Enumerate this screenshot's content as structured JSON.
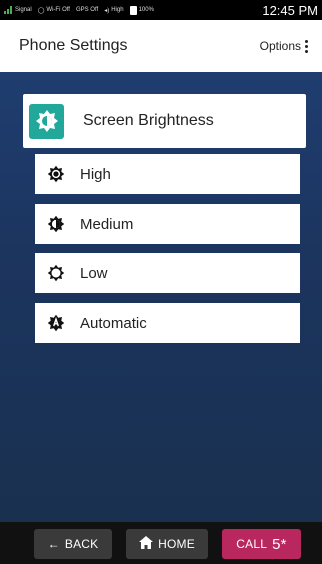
{
  "status_bar": {
    "signal": "Signal",
    "wifi": "Wi-Fi Off",
    "gps": "GPS Off",
    "volume": "High",
    "battery": "100%",
    "time": "12:45 PM"
  },
  "header": {
    "title": "Phone Settings",
    "options_label": "Options"
  },
  "main_card": {
    "label": "Screen Brightness",
    "icon": "brightness-icon"
  },
  "options": [
    {
      "label": "High",
      "icon": "brightness-high-icon"
    },
    {
      "label": "Medium",
      "icon": "brightness-medium-icon"
    },
    {
      "label": "Low",
      "icon": "brightness-low-icon"
    },
    {
      "label": "Automatic",
      "icon": "brightness-auto-icon"
    }
  ],
  "bottom_bar": {
    "back_label": "BACK",
    "home_label": "HOME",
    "call_label": "CALL",
    "call_number": "5*"
  },
  "colors": {
    "accent": "#21a89b",
    "call_button": "#b8275e",
    "content_bg": "#1f3d6f"
  }
}
